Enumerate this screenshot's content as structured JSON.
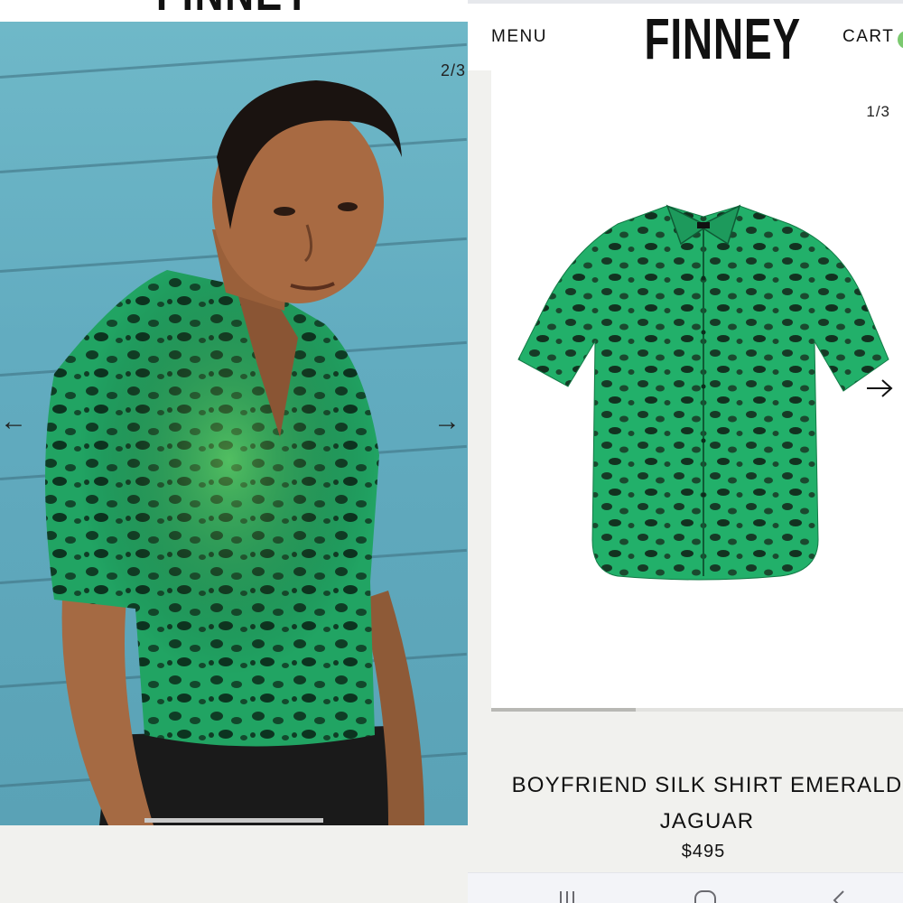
{
  "left_screen": {
    "brand_partial": "FINNEY",
    "image_counter": "2/3",
    "prev_arrow": "←",
    "next_arrow": "→"
  },
  "right_screen": {
    "header": {
      "menu_label": "MENU",
      "brand": "FINNEY",
      "cart_label": "CART"
    },
    "gallery": {
      "image_counter": "1/3",
      "next_arrow": "→",
      "progress_fraction": 0.35
    },
    "product": {
      "title": "BOYFRIEND SILK SHIRT EMERALD JAGUAR",
      "price": "$495"
    },
    "system_nav": {
      "recents_icon": "recents-icon",
      "home_icon": "home-icon",
      "back_icon": "back-icon"
    }
  },
  "colors": {
    "wall_blue": "#62acc0",
    "shirt_green": "#1fa866",
    "cart_badge": "#7bc96f"
  }
}
